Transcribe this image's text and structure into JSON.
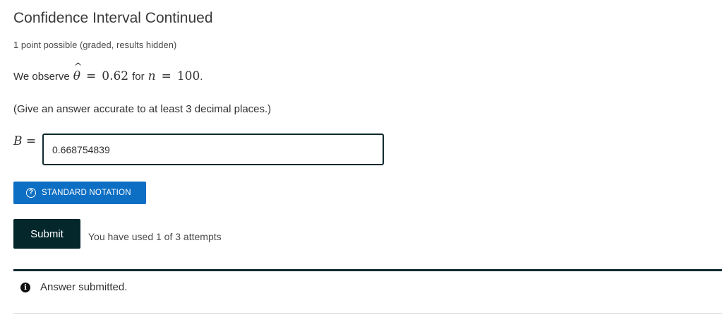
{
  "problem": {
    "title": "Confidence Interval Continued",
    "points": "1 point possible (graded, results hidden)",
    "observe": {
      "prefix": "We observe",
      "theta_symbol": "θ",
      "hat_symbol": "^",
      "eq1": "=",
      "theta_value": "0.62",
      "for_word": "for",
      "n_symbol": "n",
      "eq2": "=",
      "n_value": "100",
      "suffix": "."
    },
    "instruction": "(Give an answer accurate to at least 3 decimal places.)",
    "answer": {
      "variable": "B",
      "equals": "=",
      "value": "0.668754839"
    },
    "notation_button": {
      "icon": "?",
      "label": "STANDARD NOTATION"
    },
    "submit_button": {
      "label": "Submit"
    },
    "attempts_text": "You have used 1 of 3 attempts",
    "notification": {
      "icon": "i",
      "text": "Answer submitted."
    }
  },
  "colors": {
    "primary_button": "#0d6fc4",
    "submit_button": "#03272b",
    "input_border": "#0f2a2e",
    "notification_border": "#0f2a2e"
  },
  "icons": [
    "question-circle-icon",
    "info-circle-icon"
  ]
}
